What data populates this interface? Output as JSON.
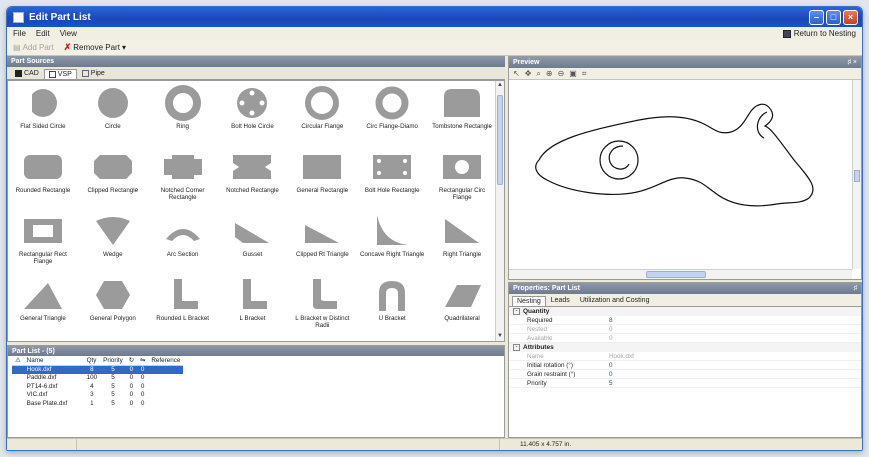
{
  "window": {
    "title": "Edit Part List"
  },
  "menu": {
    "file": "File",
    "edit": "Edit",
    "view": "View",
    "return": "Return to Nesting"
  },
  "toolbar": {
    "add": "Add Part",
    "remove": "Remove Part"
  },
  "sources": {
    "header": "Part Sources",
    "tabs": [
      "CAD",
      "VSP",
      "Pipe"
    ],
    "shapes": [
      "Flat Sided Circle",
      "Circle",
      "Ring",
      "Bolt Hole Circle",
      "Circular Flange",
      "Circ Flange-Diamo",
      "Tombstone Rectangle",
      "Rounded Rectangle",
      "Clipped Rectangle",
      "Notched Corner Rectangle",
      "Notched Rectangle",
      "General Rectangle",
      "Bolt Hole Rectangle",
      "Rectangular Circ Flange",
      "Rectangular Rect Flange",
      "Wedge",
      "Arc Section",
      "Gusset",
      "Clipped Rt Triangle",
      "Concave Right Triangle",
      "Right Triangle",
      "General Triangle",
      "General Polygon",
      "Rounded L Bracket",
      "L Bracket",
      "L Bracket w Distinct Radii",
      "U Bracket",
      "Quadrilateral"
    ]
  },
  "partlist": {
    "header": "Part List - (5)",
    "columns": [
      "Name",
      "Qty",
      "Priority",
      "",
      "",
      "Reference"
    ],
    "rows": [
      {
        "name": "Hook.dxf",
        "qty": "8",
        "priority": "5",
        "a": "0",
        "b": "0",
        "selected": true
      },
      {
        "name": "Paddle.dxf",
        "qty": "100",
        "priority": "5",
        "a": "0",
        "b": "0",
        "selected": false
      },
      {
        "name": "PT14-6.dxf",
        "qty": "4",
        "priority": "5",
        "a": "0",
        "b": "0",
        "selected": false
      },
      {
        "name": "VIC.dxf",
        "qty": "3",
        "priority": "5",
        "a": "0",
        "b": "0",
        "selected": false
      },
      {
        "name": "Base Plate.dxf",
        "qty": "1",
        "priority": "5",
        "a": "0",
        "b": "0",
        "selected": false
      }
    ]
  },
  "preview": {
    "header": "Preview",
    "pin": "♯ ×"
  },
  "properties": {
    "header": "Properties: Part List",
    "pin": "♯",
    "tabs": [
      "Nesting",
      "Leads",
      "Utilization and Costing"
    ],
    "quantity_group": "Quantity",
    "quantity": [
      {
        "k": "Required",
        "v": "8",
        "dim": false
      },
      {
        "k": "Nested",
        "v": "0",
        "dim": true
      },
      {
        "k": "Available",
        "v": "0",
        "dim": true
      }
    ],
    "attributes_group": "Attributes",
    "attributes": [
      {
        "k": "Name",
        "v": "Hook.dxf",
        "dim": true
      },
      {
        "k": "Initial rotation (°)",
        "v": "0",
        "dim": false
      },
      {
        "k": "Grain restraint (°)",
        "v": "0",
        "dim": false
      },
      {
        "k": "Priority",
        "v": "5",
        "dim": false
      }
    ]
  },
  "status": {
    "dims": "11.405 x 4.757 in."
  }
}
